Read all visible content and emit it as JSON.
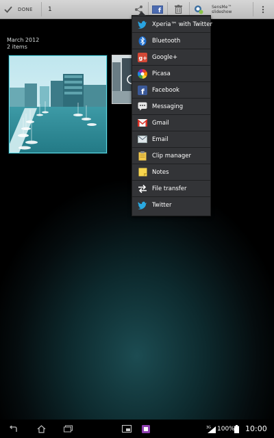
{
  "action_bar": {
    "done_label": "DONE",
    "selected_count": "1",
    "slideshow_label": "SensMe™ slideshow"
  },
  "album": {
    "date": "March 2012",
    "items_count": "2 items"
  },
  "share_menu": {
    "items": [
      {
        "label": "Xperia™ with Twitter",
        "icon": "xperia-twitter-icon"
      },
      {
        "label": "Bluetooth",
        "icon": "bluetooth-icon"
      },
      {
        "label": "Google+",
        "icon": "google-plus-icon"
      },
      {
        "label": "Picasa",
        "icon": "picasa-icon"
      },
      {
        "label": "Facebook",
        "icon": "facebook-icon"
      },
      {
        "label": "Messaging",
        "icon": "messaging-icon"
      },
      {
        "label": "Gmail",
        "icon": "gmail-icon"
      },
      {
        "label": "Email",
        "icon": "email-icon"
      },
      {
        "label": "Clip manager",
        "icon": "clip-manager-icon"
      },
      {
        "label": "Notes",
        "icon": "notes-icon"
      },
      {
        "label": "File transfer",
        "icon": "file-transfer-icon"
      },
      {
        "label": "Twitter",
        "icon": "twitter-icon"
      }
    ]
  },
  "status_bar": {
    "network": "3G",
    "battery_percent": "100%",
    "time": "10:00"
  },
  "colors": {
    "action_bar": "#c9c9c9",
    "menu_bg": "#333437",
    "selection_border": "#5fe0ea",
    "background": "#0d2a2e"
  }
}
